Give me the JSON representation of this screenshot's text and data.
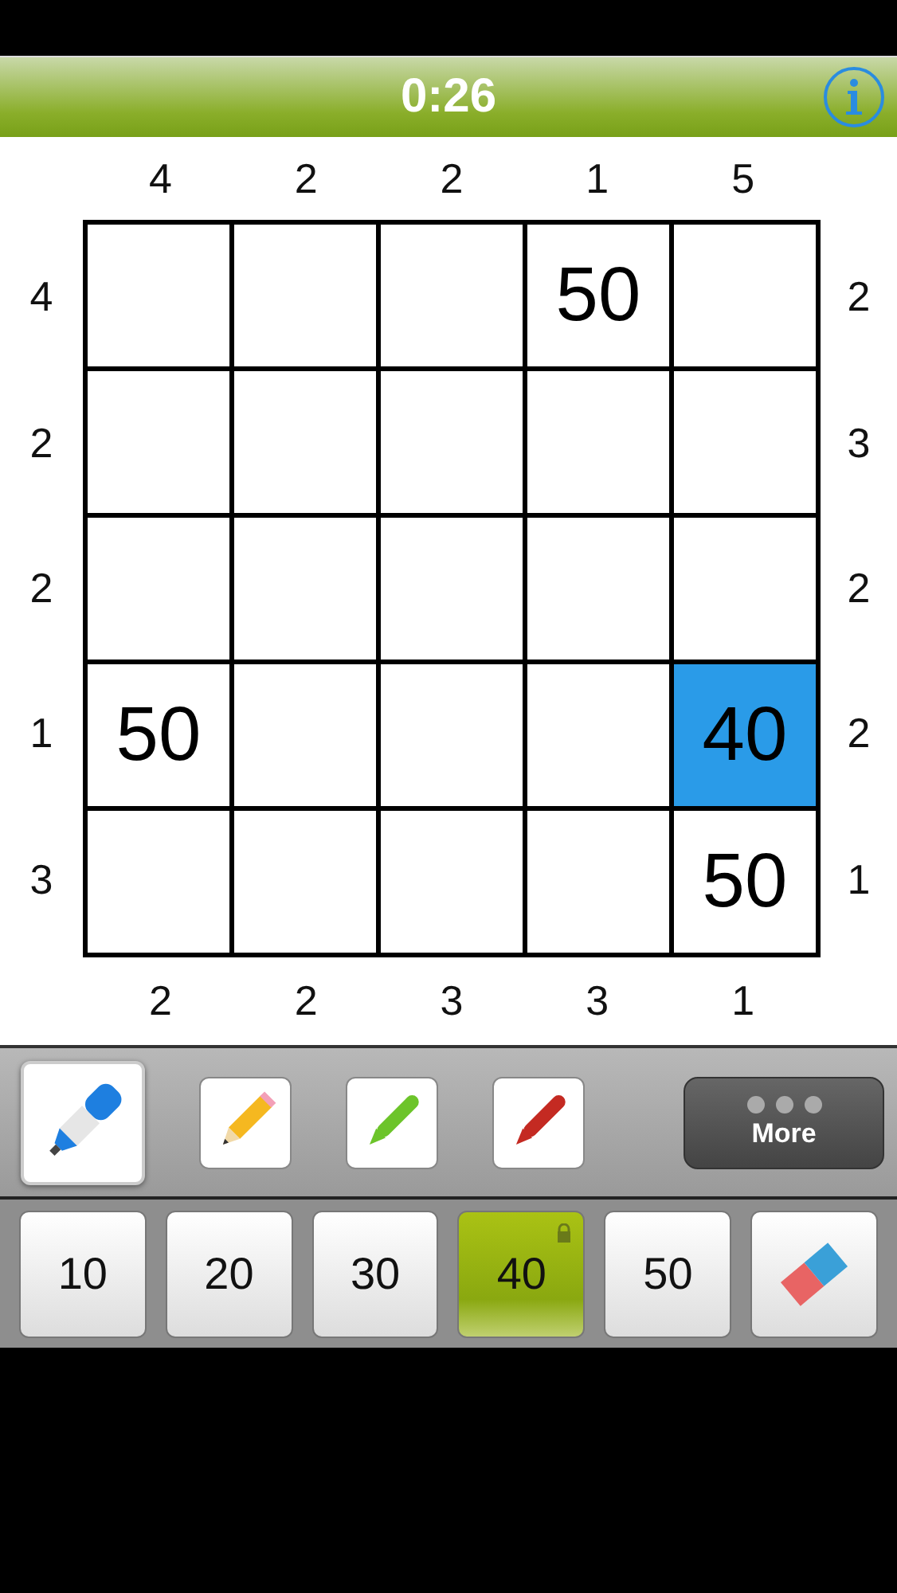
{
  "header": {
    "timer": "0:26"
  },
  "puzzle": {
    "top_clues": [
      "4",
      "2",
      "2",
      "1",
      "5"
    ],
    "left_clues": [
      "4",
      "2",
      "2",
      "1",
      "3"
    ],
    "right_clues": [
      "2",
      "3",
      "2",
      "2",
      "1"
    ],
    "bottom_clues": [
      "2",
      "2",
      "3",
      "3",
      "1"
    ],
    "rows": [
      [
        {
          "selected": false
        },
        {
          "selected": false
        },
        {
          "selected": false
        },
        {
          "value": "50",
          "selected": false
        },
        {
          "selected": false
        }
      ],
      [
        {
          "selected": false
        },
        {
          "selected": false
        },
        {
          "selected": false
        },
        {
          "selected": false
        },
        {
          "selected": false
        }
      ],
      [
        {
          "selected": false
        },
        {
          "selected": false
        },
        {
          "selected": false
        },
        {
          "selected": false
        },
        {
          "selected": false
        }
      ],
      [
        {
          "value": "50",
          "selected": false
        },
        {
          "selected": false
        },
        {
          "selected": false
        },
        {
          "selected": false
        },
        {
          "value": "40",
          "selected": true
        }
      ],
      [
        {
          "selected": false
        },
        {
          "selected": false
        },
        {
          "selected": false
        },
        {
          "selected": false
        },
        {
          "value": "50",
          "selected": false
        }
      ]
    ]
  },
  "tools": [
    {
      "kind": "marker",
      "color": "#1e7fe0",
      "selected": true
    },
    {
      "kind": "pencil",
      "color": "#f5b820",
      "selected": false
    },
    {
      "kind": "pen",
      "color": "#6cc42a",
      "selected": false
    },
    {
      "kind": "pen",
      "color": "#c42a22",
      "selected": false
    }
  ],
  "more_button": {
    "label": "More"
  },
  "number_keys": [
    {
      "label": "10",
      "selected": false,
      "locked": false
    },
    {
      "label": "20",
      "selected": false,
      "locked": false
    },
    {
      "label": "30",
      "selected": false,
      "locked": false
    },
    {
      "label": "40",
      "selected": true,
      "locked": true
    },
    {
      "label": "50",
      "selected": false,
      "locked": false
    }
  ]
}
